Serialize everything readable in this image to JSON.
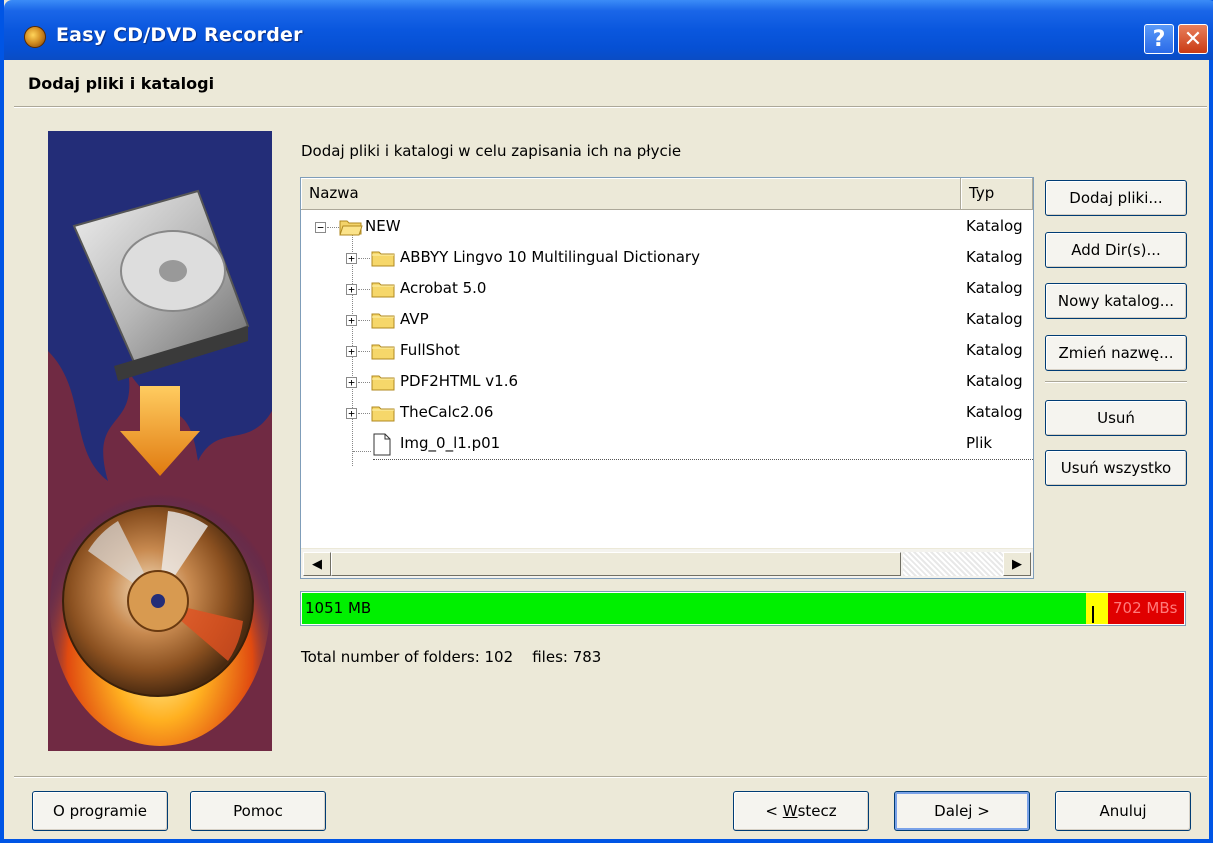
{
  "window": {
    "title": "Easy CD/DVD Recorder",
    "help_label": "?",
    "close_label": "✕"
  },
  "header": {
    "title": "Dodaj pliki i katalogi"
  },
  "main": {
    "instruction": "Dodaj pliki i katalogi w celu zapisania ich na płycie"
  },
  "list": {
    "columns": {
      "name": "Nazwa",
      "type": "Typ"
    },
    "root": {
      "name": "NEW",
      "type": "Katalog",
      "expander": "−"
    },
    "children": [
      {
        "name": "ABBYY Lingvo 10 Multilingual Dictionary",
        "type": "Katalog",
        "kind": "folder",
        "expander": "+"
      },
      {
        "name": "Acrobat 5.0",
        "type": "Katalog",
        "kind": "folder",
        "expander": "+"
      },
      {
        "name": "AVP",
        "type": "Katalog",
        "kind": "folder",
        "expander": "+"
      },
      {
        "name": "FullShot",
        "type": "Katalog",
        "kind": "folder",
        "expander": "+"
      },
      {
        "name": "PDF2HTML v1.6",
        "type": "Katalog",
        "kind": "folder",
        "expander": "+"
      },
      {
        "name": "TheCalc2.06",
        "type": "Katalog",
        "kind": "folder",
        "expander": "+"
      },
      {
        "name": "Img_0_l1.p01",
        "type": "Plik",
        "kind": "file"
      }
    ],
    "scroll_left": "◀",
    "scroll_right": "▶"
  },
  "side_buttons": {
    "add_files": "Dodaj pliki...",
    "add_dirs": "Add Dir(s)...",
    "new_folder": "Nowy katalog...",
    "rename": "Zmień nazwę...",
    "remove": "Usuń",
    "remove_all": "Usuń wszystko"
  },
  "capacity": {
    "used_label": "1051 MB",
    "overflow_label": "702 MBs",
    "colors": {
      "ok": "#00f000",
      "warn": "#ffff00",
      "over": "#e00000"
    }
  },
  "stats": {
    "text": "Total number of folders: 102    files: 783"
  },
  "footer": {
    "about": "O programie",
    "help": "Pomoc",
    "back_prefix": "< ",
    "back_mnemonic": "W",
    "back_rest": "stecz",
    "next": "Dalej >",
    "cancel": "Anuluj"
  }
}
